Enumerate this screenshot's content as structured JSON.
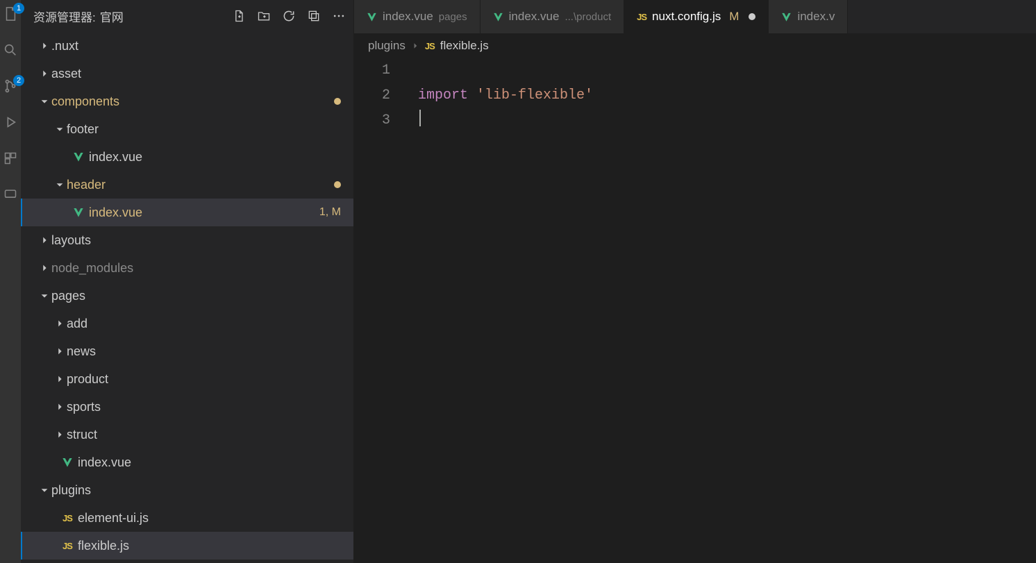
{
  "sidebar": {
    "title_prefix": "资源管理器:",
    "project_name": "官网",
    "actions": [
      "new-file",
      "new-folder",
      "refresh",
      "collapse-all",
      "more"
    ],
    "badges": {
      "explorer": "1",
      "scm": "2"
    }
  },
  "tree": {
    "nuxt": ".nuxt",
    "asset": "asset",
    "components": "components",
    "footer": "footer",
    "footer_index": "index.vue",
    "header": "header",
    "header_index": "index.vue",
    "header_index_status": "1, M",
    "layouts": "layouts",
    "node_modules": "node_modules",
    "pages": "pages",
    "add": "add",
    "news": "news",
    "product": "product",
    "sports": "sports",
    "struct": "struct",
    "pages_index": "index.vue",
    "plugins": "plugins",
    "element_ui": "element-ui.js",
    "flexible": "flexible.js"
  },
  "tabs": [
    {
      "icon": "vue",
      "name": "index.vue",
      "suffix": "pages",
      "active": false
    },
    {
      "icon": "vue",
      "name": "index.vue",
      "suffix": "...\\product",
      "active": false
    },
    {
      "icon": "js",
      "name": "nuxt.config.js",
      "mod_letter": "M",
      "dirty": true,
      "active": true
    },
    {
      "icon": "vue",
      "name": "index.v",
      "active": false,
      "cut": true
    }
  ],
  "breadcrumb": {
    "part1": "plugins",
    "file_icon": "js",
    "file": "flexible.js"
  },
  "editor": {
    "lines": [
      "1",
      "2",
      "3"
    ],
    "code": {
      "l1": "",
      "l2_import": "import",
      "l2_str": "'lib-flexible'",
      "l3": ""
    }
  }
}
